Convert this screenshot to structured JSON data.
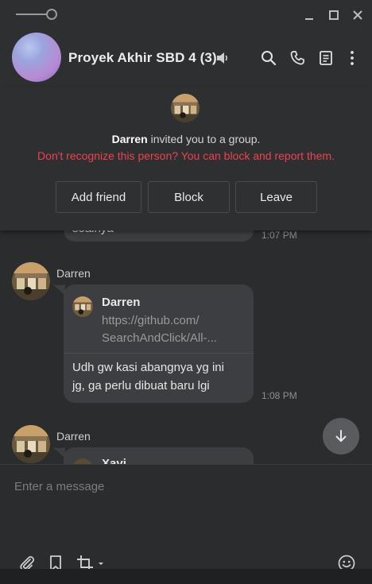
{
  "window": {
    "controls": [
      "minimize-icon",
      "maximize-icon",
      "close-icon"
    ]
  },
  "header": {
    "title": "Proyek Akhir SBD 4 (3)",
    "icons": [
      "speaker-icon",
      "search-icon",
      "phone-icon",
      "notes-icon",
      "more-icon"
    ]
  },
  "invite": {
    "inviter": "Darren",
    "message": "invited you to a group.",
    "warning": "Don't recognize this person? You can block and report them.",
    "buttons": {
      "add_friend": "Add friend",
      "block": "Block",
      "leave": "Leave"
    }
  },
  "messages": [
    {
      "partial_text": "soalnya",
      "time": "1:07 PM"
    },
    {
      "sender": "Darren",
      "quote": {
        "name": "Darren",
        "text_line1": "https://github.com/",
        "text_line2": "SearchAndClick/All-..."
      },
      "text_line1": "Udh gw kasi abangnya yg ini",
      "text_line2": "jg, ga perlu dibuat baru lgi",
      "time": "1:08 PM"
    },
    {
      "sender": "Darren",
      "quote_name_partial": "Xavi"
    }
  ],
  "composer": {
    "placeholder": "Enter a message",
    "icons": [
      "attach-icon",
      "bookmark-icon",
      "crop-icon",
      "emoji-icon"
    ]
  },
  "colors": {
    "warning": "#f0414f",
    "bubble": "#3d3e41",
    "background": "#2b2c2e"
  }
}
